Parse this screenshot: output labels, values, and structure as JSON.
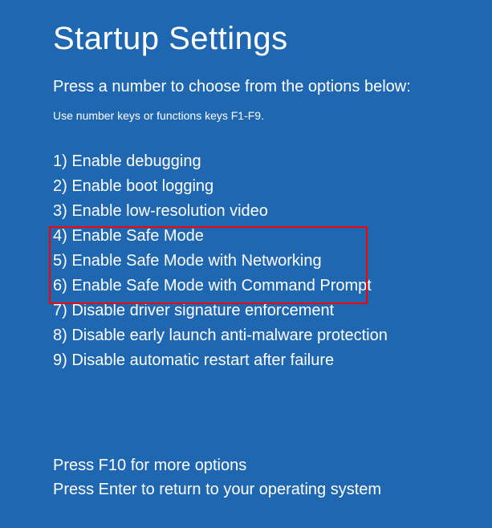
{
  "title": "Startup Settings",
  "subtitle": "Press a number to choose from the options below:",
  "hint": "Use number keys or functions keys F1-F9.",
  "options": [
    "1) Enable debugging",
    "2) Enable boot logging",
    "3) Enable low-resolution video",
    "4) Enable Safe Mode",
    "5) Enable Safe Mode with Networking",
    "6) Enable Safe Mode with Command Prompt",
    "7) Disable driver signature enforcement",
    "8) Disable early launch anti-malware protection",
    "9) Disable automatic restart after failure"
  ],
  "footer": {
    "more": "Press F10 for more options",
    "return": "Press Enter to return to your operating system"
  }
}
